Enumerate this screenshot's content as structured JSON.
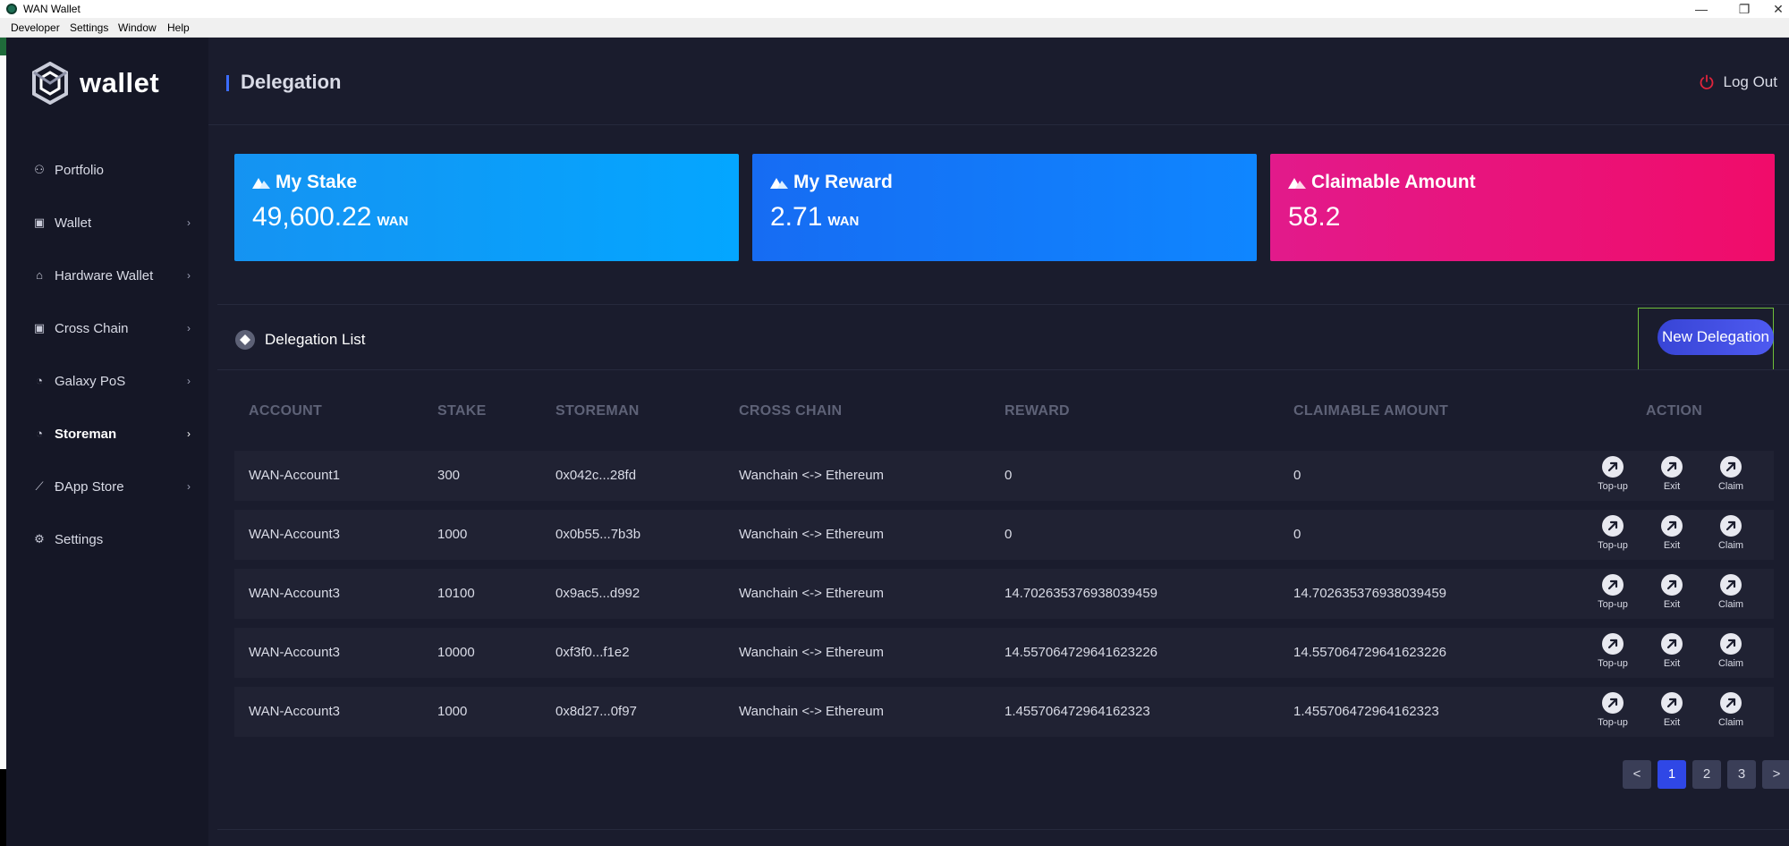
{
  "window": {
    "title": "WAN Wallet",
    "minimize": "—",
    "restore": "❐",
    "close": "✕"
  },
  "menubar": [
    "Developer",
    "Settings",
    "Window",
    "Help"
  ],
  "sidebar": {
    "brand": "wallet",
    "items": [
      {
        "label": "Portfolio",
        "icon": "user-icon",
        "glyph": "⚇",
        "chevron": ""
      },
      {
        "label": "Wallet",
        "icon": "wallet-icon",
        "glyph": "▣",
        "chevron": "›"
      },
      {
        "label": "Hardware Wallet",
        "icon": "usb-icon",
        "glyph": "⌂",
        "chevron": "›"
      },
      {
        "label": "Cross Chain",
        "icon": "crosschain-icon",
        "glyph": "▣",
        "chevron": "›"
      },
      {
        "label": "Galaxy PoS",
        "icon": "pie-chart-icon",
        "glyph": "◔",
        "chevron": "›"
      },
      {
        "label": "Storeman",
        "icon": "pie-chart-icon",
        "glyph": "◔",
        "chevron": "›",
        "active": true
      },
      {
        "label": "ÐApp Store",
        "icon": "line-chart-icon",
        "glyph": "⟋",
        "chevron": "›"
      },
      {
        "label": "Settings",
        "icon": "gear-icon",
        "glyph": "⚙",
        "chevron": ""
      }
    ],
    "collapse": "‹"
  },
  "header": {
    "title": "Delegation",
    "logout": "Log Out"
  },
  "cards": [
    {
      "title": "My Stake",
      "value": "49,600.22",
      "unit": "WAN"
    },
    {
      "title": "My Reward",
      "value": "2.71",
      "unit": "WAN"
    },
    {
      "title": "Claimable Amount",
      "value": "58.2",
      "unit": ""
    }
  ],
  "list": {
    "title": "Delegation List",
    "new_button": "New Delegation"
  },
  "table": {
    "columns": [
      "ACCOUNT",
      "STAKE",
      "STOREMAN",
      "CROSS CHAIN",
      "REWARD",
      "CLAIMABLE AMOUNT",
      "ACTION"
    ],
    "actions": [
      "Top-up",
      "Exit",
      "Claim"
    ],
    "rows": [
      {
        "account": "WAN-Account1",
        "stake": "300",
        "storeman": "0x042c...28fd",
        "cross_chain": "Wanchain <-> Ethereum",
        "reward": "0",
        "claimable": "0"
      },
      {
        "account": "WAN-Account3",
        "stake": "1000",
        "storeman": "0x0b55...7b3b",
        "cross_chain": "Wanchain <-> Ethereum",
        "reward": "0",
        "claimable": "0"
      },
      {
        "account": "WAN-Account3",
        "stake": "10100",
        "storeman": "0x9ac5...d992",
        "cross_chain": "Wanchain <-> Ethereum",
        "reward": "14.702635376938039459",
        "claimable": "14.702635376938039459"
      },
      {
        "account": "WAN-Account3",
        "stake": "10000",
        "storeman": "0xf3f0...f1e2",
        "cross_chain": "Wanchain <-> Ethereum",
        "reward": "14.557064729641623226",
        "claimable": "14.557064729641623226"
      },
      {
        "account": "WAN-Account3",
        "stake": "1000",
        "storeman": "0x8d27...0f97",
        "cross_chain": "Wanchain <-> Ethereum",
        "reward": "1.455706472964162323",
        "claimable": "1.455706472964162323"
      }
    ]
  },
  "pagination": {
    "prev": "<",
    "pages": [
      "1",
      "2",
      "3"
    ],
    "current": "1",
    "next": ">"
  },
  "colors": {
    "sidebar_bg": "#151726",
    "main_bg": "#1a1c2d",
    "accent": "#3845d6",
    "stake_card": "#04a6ff",
    "reward_card": "#0f86ff",
    "claimable_card": "#f00c6a"
  }
}
